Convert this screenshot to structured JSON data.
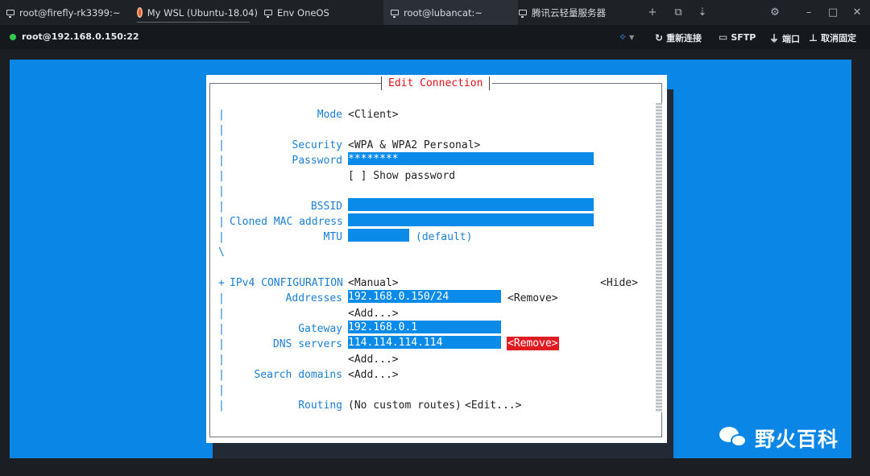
{
  "tabs": [
    {
      "label": "root@firefly-rk3399:~",
      "icon": "monitor-icon"
    },
    {
      "label": "My WSL (Ubuntu-18.04)",
      "icon": "ubuntu-icon"
    },
    {
      "label": "Env OneOS",
      "icon": "monitor-icon"
    },
    {
      "label": "root@lubancat:~",
      "icon": "monitor-icon",
      "close": "×"
    },
    {
      "label": "腾讯云轻量服务器",
      "icon": "monitor-icon"
    }
  ],
  "tab_actions": {
    "add": "+",
    "clone": "⧉",
    "download": "⇣"
  },
  "window": {
    "settings": "⚙",
    "minimize": "–",
    "maximize": "□",
    "close": "✕"
  },
  "toolbar": {
    "connection": "root@192.168.0.150:22",
    "connection_status_color": "#2ecc4a",
    "bulb": "💡",
    "reconnect": "重新连接",
    "sftp": "SFTP",
    "port": "端口",
    "pin": "取消固定"
  },
  "dialog": {
    "title": "Edit Connection",
    "mode_label": "Mode",
    "mode_value": "<Client>",
    "security_label": "Security",
    "security_value": "<WPA & WPA2 Personal>",
    "password_label": "Password",
    "password_value": "********",
    "show_password": "[ ] Show password",
    "bssid_label": "BSSID",
    "bssid_value": "",
    "cloned_mac_label": "Cloned MAC address",
    "cloned_mac_value": "",
    "mtu_label": "MTU",
    "mtu_value": "",
    "mtu_hint": "(default)",
    "ipv4_label": "IPv4 CONFIGURATION",
    "ipv4_value": "<Manual>",
    "hide": "<Hide>",
    "addresses_label": "Addresses",
    "address_value": "192.168.0.150/24",
    "remove": "<Remove>",
    "add": "<Add...>",
    "gateway_label": "Gateway",
    "gateway_value": "192.168.0.1",
    "dns_label": "DNS servers",
    "dns_value": "114.114.114.114",
    "search_domains_label": "Search domains",
    "routing_label": "Routing",
    "routing_value": "(No custom routes)",
    "edit": "<Edit...>",
    "plus": "+",
    "bar": "|",
    "backslash": "\\"
  },
  "colors": {
    "terminal_bg": "#0a87e6",
    "field_bg": "#0a8bea",
    "label": "#1c7fd6",
    "danger": "#e01b22"
  },
  "watermark": {
    "text": "野火百科"
  }
}
